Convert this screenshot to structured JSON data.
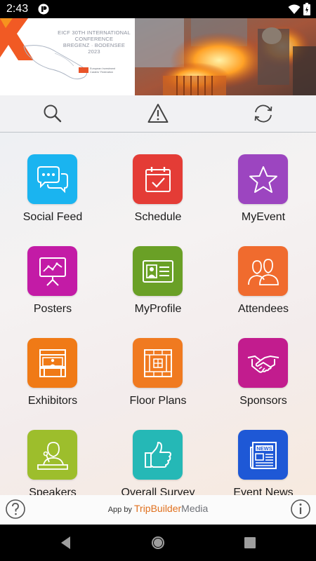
{
  "status_bar": {
    "time": "2:43"
  },
  "banner": {
    "title_lines": [
      "EICF 30TH INTERNATIONAL",
      "CONFERENCE",
      "BREGENZ · BODENSEE",
      "2023"
    ],
    "logo_text": "European Investment Casters' Federation"
  },
  "toolbar": {
    "icons": [
      "search-icon",
      "warning-icon",
      "refresh-icon"
    ]
  },
  "tiles": [
    {
      "label": "Social Feed",
      "color": "#1ab4f0",
      "icon": "chat-icon"
    },
    {
      "label": "Schedule",
      "color": "#e43c36",
      "icon": "calendar-icon"
    },
    {
      "label": "MyEvent",
      "color": "#9c45c0",
      "icon": "star-icon"
    },
    {
      "label": "Posters",
      "color": "#c31ba6",
      "icon": "presentation-icon"
    },
    {
      "label": "MyProfile",
      "color": "#6aa026",
      "icon": "id-card-icon"
    },
    {
      "label": "Attendees",
      "color": "#f06b2e",
      "icon": "people-icon"
    },
    {
      "label": "Exhibitors",
      "color": "#f07a16",
      "icon": "booth-icon"
    },
    {
      "label": "Floor Plans",
      "color": "#f07a20",
      "icon": "floor-plan-icon"
    },
    {
      "label": "Sponsors",
      "color": "#c21c8e",
      "icon": "handshake-icon"
    },
    {
      "label": "Speakers",
      "color": "#9dbe2c",
      "icon": "speaker-icon"
    },
    {
      "label": "Overall Survey",
      "color": "#25b8b6",
      "icon": "thumbs-up-icon"
    },
    {
      "label": "Event News",
      "color": "#1e58d6",
      "icon": "newspaper-icon"
    }
  ],
  "footer": {
    "prefix": "App by",
    "brand_part1": "TripBuilder",
    "brand_part2": "Media"
  }
}
